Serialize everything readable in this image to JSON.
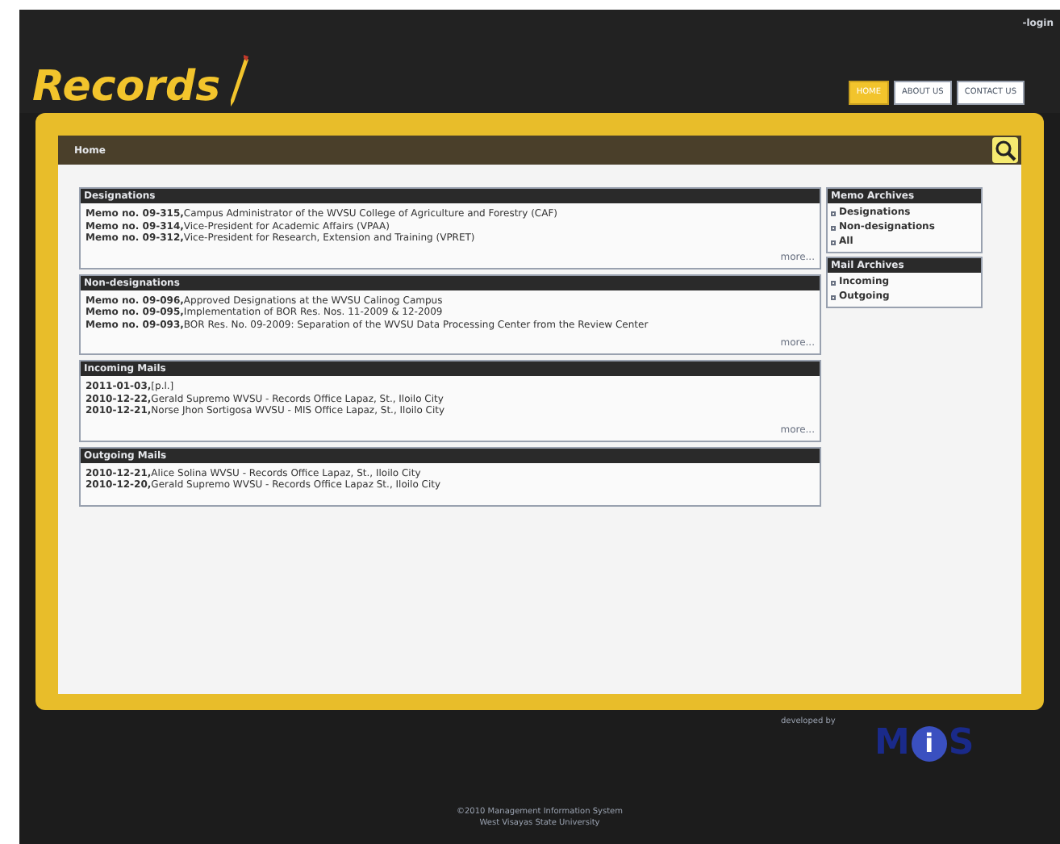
{
  "header": {
    "login_link": "-login",
    "logo": "Records",
    "nav": [
      {
        "label": "HOME",
        "selected": true
      },
      {
        "label": "ABOUT US",
        "selected": false
      },
      {
        "label": "CONTACT US",
        "selected": false
      }
    ]
  },
  "breadcrumb": "Home",
  "sections": [
    {
      "title": "Designations",
      "items": [
        "**Memo no. 09-315,**Campus Administrator of the WVSU College of Agriculture and Forestry (CAF)",
        "**Memo no. 09-314,**Vice-President for Academic Affairs (VPAA)",
        "**Memo no. 09-312,**Vice-President for Research, Extension and Training (VPRET)"
      ],
      "more": "more..."
    },
    {
      "title": "Non-designations",
      "items": [
        "**Memo no. 09-096,**Approved Designations at the WVSU Calinog Campus",
        "**Memo no. 09-095,**Implementation of BOR Res. Nos. 11-2009 & 12-2009",
        "**Memo no. 09-093,**BOR Res. No. 09-2009: Separation of the WVSU Data Processing Center from the Review Center"
      ],
      "more": "more..."
    },
    {
      "title": "Incoming Mails",
      "items": [
        "**2011-01-03,**[p.l.]",
        "**2010-12-22,**Gerald Supremo WVSU - Records Office Lapaz, St., Iloilo City",
        "**2010-12-21,**Norse Jhon Sortigosa WVSU - MIS Office Lapaz, St., Iloilo City"
      ],
      "more": "more..."
    },
    {
      "title": "Outgoing Mails",
      "items": [
        "**2010-12-21,**Alice Solina WVSU - Records Office Lapaz, St., Iloilo City",
        "**2010-12-20,**Gerald Supremo WVSU - Records Office Lapaz St., Iloilo City"
      ]
    }
  ],
  "sidebar": [
    {
      "title": "Memo Archives",
      "links": [
        "Designations",
        "Non-designations",
        "All"
      ]
    },
    {
      "title": "Mail Archives",
      "links": [
        "Incoming",
        "Outgoing"
      ]
    }
  ],
  "footer": {
    "developed_by": "developed by",
    "mis_logo": [
      "M",
      "i",
      "S"
    ],
    "copyright": "©2010 Management Information System",
    "university": "West Visayas State University"
  }
}
